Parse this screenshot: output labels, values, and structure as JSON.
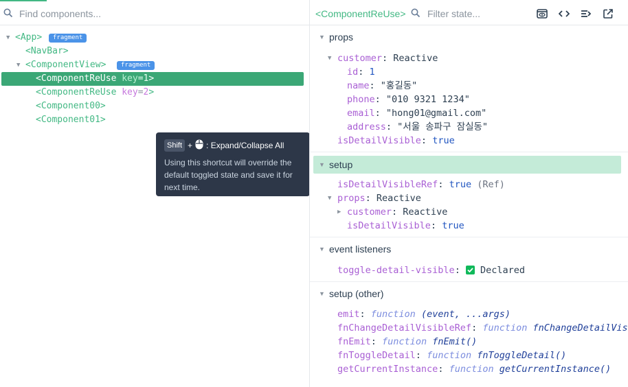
{
  "left": {
    "search_placeholder": "Find components...",
    "tree": [
      {
        "open": "<",
        "name": "App",
        "close": ">",
        "badge": "fragment",
        "arrow": "▼"
      },
      {
        "open": "<",
        "name": "NavBar",
        "close": ">"
      },
      {
        "open": "<",
        "name": "ComponentView",
        "close": ">",
        "badge": "fragment",
        "arrow": "▼"
      },
      {
        "open": "<",
        "name": "ComponentReUse",
        "key_attr": "key",
        "key_eq": "=",
        "key_val": "1",
        "close": ">",
        "selected": true
      },
      {
        "open": "<",
        "name": "ComponentReUse",
        "key_attr": "key",
        "key_eq": "=",
        "key_val": "2",
        "close": ">"
      },
      {
        "open": "<",
        "name": "Component00",
        "close": ">"
      },
      {
        "open": "<",
        "name": "Component01",
        "close": ">"
      }
    ],
    "tooltip": {
      "key": "Shift",
      "plus": "+",
      "mouse_icon": "mouse-icon",
      "title": ": Expand/Collapse All",
      "description": "Using this shortcut will override the default toggled state and save it for next time."
    }
  },
  "right": {
    "component_name": "<ComponentReUse>",
    "filter_placeholder": "Filter state...",
    "toolbar_icons": [
      "eye-icon",
      "code-icon",
      "filter-lines-icon",
      "open-external-icon"
    ],
    "sections": {
      "props": {
        "title": "props",
        "customer": {
          "key": "customer",
          "type": "Reactive"
        },
        "fields": [
          {
            "key": "id",
            "value": "1",
            "kind": "num"
          },
          {
            "key": "name",
            "value": "\"홍길동\"",
            "kind": "str"
          },
          {
            "key": "phone",
            "value": "\"010 9321 1234\"",
            "kind": "str"
          },
          {
            "key": "email",
            "value": "\"hong01@gmail.com\"",
            "kind": "str"
          },
          {
            "key": "address",
            "value": "\"서울 송파구 잠실동\"",
            "kind": "str"
          }
        ],
        "isDetailVisible": {
          "key": "isDetailVisible",
          "value": "true"
        }
      },
      "setup": {
        "title": "setup",
        "isDetailVisibleRef": {
          "key": "isDetailVisibleRef",
          "value": "true",
          "suffix": "(Ref)"
        },
        "props": {
          "key": "props",
          "type": "Reactive"
        },
        "customer": {
          "key": "customer",
          "type": "Reactive"
        },
        "isDetailVisible": {
          "key": "isDetailVisible",
          "value": "true"
        }
      },
      "events": {
        "title": "event listeners",
        "item": {
          "key": "toggle-detail-visible",
          "value": "Declared"
        }
      },
      "other": {
        "title": "setup (other)",
        "items": [
          {
            "key": "emit",
            "kw": "function",
            "sig": "(event, ...args)"
          },
          {
            "key": "fnChangeDetailVisibleRef",
            "kw": "function",
            "sig": "fnChangeDetailVisibleRef()"
          },
          {
            "key": "fnEmit",
            "kw": "function",
            "sig": "fnEmit()"
          },
          {
            "key": "fnToggleDetail",
            "kw": "function",
            "sig": "fnToggleDetail()"
          },
          {
            "key": "getCurrentInstance",
            "kw": "function",
            "sig": "getCurrentInstance()"
          }
        ]
      }
    }
  },
  "colors": {
    "accent": "#42b883",
    "selected": "#3ba776",
    "badge": "#4b93e8",
    "tooltip_bg": "#2d3748",
    "highlight": "#c4ebd8"
  }
}
